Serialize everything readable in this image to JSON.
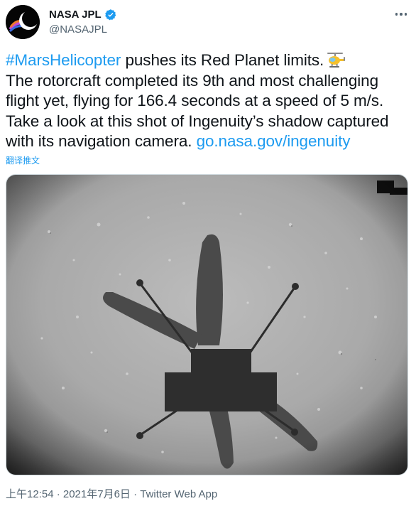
{
  "tweet": {
    "display_name": "NASA JPL",
    "handle": "@NASAJPL",
    "hashtag": "#MarsHelicopter",
    "text_part1": " pushes its Red Planet limits.",
    "text_part2": "The rotorcraft completed its 9th and most challenging flight yet, flying for 166.4 seconds at a speed of 5 m/s. Take a look at this shot of Ingenuity’s shadow captured with its navigation camera. ",
    "link": "go.nasa.gov/ingenuity",
    "translate_label": "翻译推文",
    "timestamp": "上午12:54 · 2021年7月6日 · Twitter Web App",
    "image_alt": "Ingenuity’s shadow captured with its navigation camera"
  },
  "icons": {
    "verified": "verified-badge-icon",
    "more": "more-options-icon",
    "helicopter": "helicopter-emoji-icon"
  },
  "colors": {
    "link": "#1d9bf0",
    "secondary_text": "#536471",
    "primary_text": "#0f1419"
  }
}
